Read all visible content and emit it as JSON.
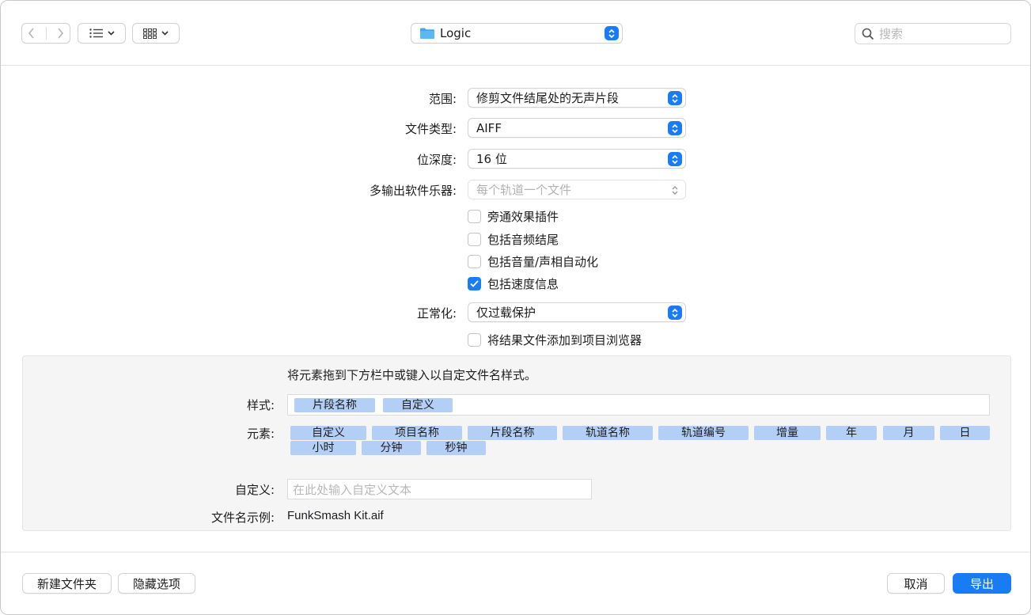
{
  "toolbar": {
    "location": "Logic",
    "search_placeholder": "搜索"
  },
  "options": {
    "range_label": "范围:",
    "range_value": "修剪文件结尾处的无声片段",
    "filetype_label": "文件类型:",
    "filetype_value": "AIFF",
    "bitdepth_label": "位深度:",
    "bitdepth_value": "16 位",
    "multiout_label": "多输出软件乐器:",
    "multiout_value": "每个轨道一个文件",
    "checkboxes": [
      {
        "label": "旁通效果插件",
        "checked": false
      },
      {
        "label": "包括音频结尾",
        "checked": false
      },
      {
        "label": "包括音量/声相自动化",
        "checked": false
      },
      {
        "label": "包括速度信息",
        "checked": true
      }
    ],
    "normalize_label": "正常化:",
    "normalize_value": "仅过载保护",
    "add_to_browser": {
      "label": "将结果文件添加到项目浏览器",
      "checked": false
    }
  },
  "filename": {
    "hint": "将元素拖到下方栏中或键入以自定文件名样式。",
    "pattern_label": "样式:",
    "pattern_tokens": [
      "片段名称",
      "自定义"
    ],
    "elements_label": "元素:",
    "elements": [
      "自定义",
      "项目名称",
      "片段名称",
      "轨道名称",
      "轨道编号",
      "增量",
      "年",
      "月",
      "日",
      "小时",
      "分钟",
      "秒钟"
    ],
    "custom_label": "自定义:",
    "custom_placeholder": "在此处输入自定义文本",
    "example_label": "文件名示例:",
    "example_value": "FunkSmash Kit.aif"
  },
  "footer": {
    "new_folder": "新建文件夹",
    "hide_options": "隐藏选项",
    "cancel": "取消",
    "export": "导出"
  },
  "colors": {
    "accent": "#1a7cf5",
    "token": "#b4cff5"
  }
}
